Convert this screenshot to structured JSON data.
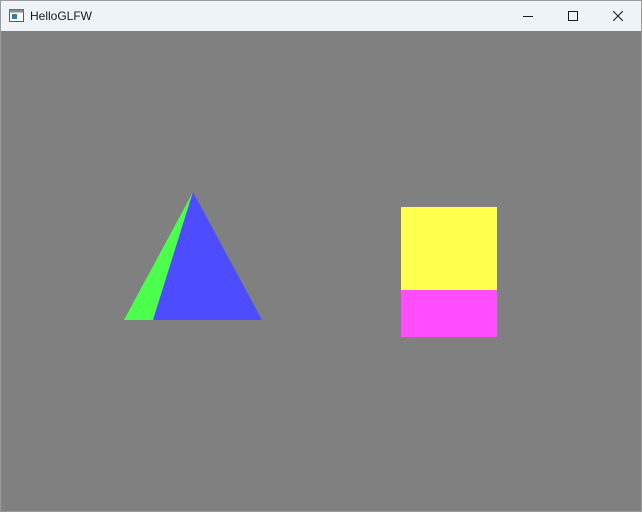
{
  "window": {
    "title": "HelloGLFW",
    "app_icon": "window-app-icon",
    "buttons": {
      "minimize": "minimize-icon",
      "maximize": "maximize-icon",
      "close": "close-icon"
    }
  },
  "scene": {
    "background_color": "#808080",
    "shapes": [
      {
        "name": "pyramid",
        "face_colors": [
          "#4dff4d",
          "#4d4dff"
        ]
      },
      {
        "name": "box",
        "face_colors": [
          "#ffff4d",
          "#ff4dff"
        ]
      }
    ]
  }
}
